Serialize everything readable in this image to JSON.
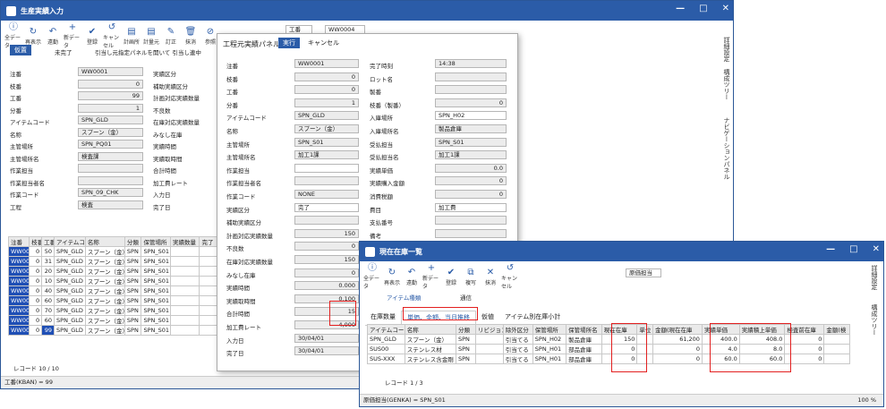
{
  "main_window": {
    "title": "生産実績入力",
    "toolbar": [
      {
        "label": "全データ",
        "icon": "info-icon"
      },
      {
        "label": "再表示",
        "icon": "refresh-icon"
      },
      {
        "label": "遠勤",
        "icon": "back-icon"
      },
      {
        "label": "新データ",
        "icon": "plus-icon"
      },
      {
        "label": "登録",
        "icon": "check-icon"
      },
      {
        "label": "キャンセル",
        "icon": "undo-icon"
      },
      {
        "label": "計画所",
        "icon": "doc-icon"
      },
      {
        "label": "計量元",
        "icon": "doc-icon"
      },
      {
        "label": "訂正",
        "icon": "pen-icon"
      },
      {
        "label": "抹消",
        "icon": "trash-icon"
      },
      {
        "label": "参照",
        "icon": "stop-icon"
      }
    ],
    "record_field": "WW0004",
    "nav_field": "工番",
    "toolbar2": {
      "lock": "仮置",
      "status": "未完了",
      "note": "引当し元指定パネルを開いて 引当し連中"
    },
    "labels": [
      "注番",
      "枝番",
      "工番",
      "分番",
      "アイテムコード",
      "名称",
      "主管場所",
      "主管場所名",
      "作業担当",
      "作業担当者名",
      "作業コード",
      "工程"
    ],
    "values": [
      "WW0001",
      "0",
      "99",
      "1",
      "SPN_GLD",
      "スプーン（金）",
      "SPN_PQ01",
      "検査課",
      "",
      "",
      "SPN_09_CHK",
      "検査"
    ],
    "labels2": [
      "実績区分",
      "補助実績区分",
      "計画対応実績数量",
      "不良数",
      "在庫対応実績数量",
      "みなし在庫",
      "実績時間",
      "実績取時間",
      "合計時間",
      "加工費レート",
      "入力日",
      "完了日"
    ],
    "grid_headers": [
      "注番",
      "枝番",
      "工番",
      "アイテムコード",
      "名称",
      "分類",
      "保管場所",
      "実績数量",
      "完了"
    ],
    "grid_rows": [
      [
        "WW0001",
        "0",
        "50",
        "SPN_GLD",
        "スプーン（金）",
        "SPN",
        "SPN_S01",
        "",
        "",
        ""
      ],
      [
        "WW0001",
        "0",
        "31",
        "SPN_GLD",
        "スプーン（金）",
        "SPN",
        "SPN_S01",
        "",
        "",
        ""
      ],
      [
        "WW0001",
        "0",
        "20",
        "SPN_GLD",
        "スプーン（金）",
        "SPN",
        "SPN_S01",
        "",
        "",
        ""
      ],
      [
        "WW0001",
        "0",
        "10",
        "SPN_GLD",
        "スプーン（金）",
        "SPN",
        "SPN_S01",
        "",
        "",
        ""
      ],
      [
        "WW0001",
        "0",
        "40",
        "SPN_GLD",
        "スプーン（金）",
        "SPN",
        "SPN_S01",
        "",
        "",
        ""
      ],
      [
        "WW0001",
        "0",
        "60",
        "SPN_GLD",
        "スプーン（金）",
        "SPN",
        "SPN_S01",
        "",
        "",
        ""
      ],
      [
        "WW0001",
        "0",
        "70",
        "SPN_GLD",
        "スプーン（金）",
        "SPN",
        "SPN_S01",
        "",
        "",
        ""
      ],
      [
        "WW0001",
        "0",
        "60",
        "SPN_GLD",
        "スプーン（金）",
        "SPN",
        "SPN_S01",
        "",
        "",
        ""
      ],
      [
        "WW0001",
        "0",
        "99",
        "SPN_GLD",
        "スプーン（金）",
        "SPN",
        "SPN_S01",
        "",
        "",
        ""
      ]
    ],
    "record_nav": "レコード 10 / 10",
    "status": "工番(KBAN) = 99",
    "side_tabs": [
      "詳細設定",
      "構成ツリー",
      "ナビゲーションパネル"
    ]
  },
  "panel": {
    "title": "工程元実績パネル",
    "exec": "実行",
    "cancel": "キャンセル",
    "left": [
      [
        "注番",
        "WW0001"
      ],
      [
        "枝番",
        "0"
      ],
      [
        "工番",
        "0"
      ],
      [
        "分番",
        "1"
      ],
      [
        "アイテムコード",
        "SPN_GLD"
      ],
      [
        "名称",
        "スプーン（金）"
      ],
      [
        "主管場所",
        "SPN_S01"
      ],
      [
        "主管場所名",
        "加工1課"
      ],
      [
        "作業担当",
        ""
      ],
      [
        "作業担当者名",
        ""
      ],
      [
        "作業コード",
        "NONE"
      ],
      [
        "実績区分",
        "完了"
      ],
      [
        "補助実績区分",
        ""
      ],
      [
        "計画対応実績数量",
        "150"
      ],
      [
        "不良数",
        "0"
      ],
      [
        "在庫対応実績数量",
        "150"
      ],
      [
        "みなし在庫",
        "0"
      ],
      [
        "実績時間",
        "0.000"
      ],
      [
        "実績取時間",
        "0.100"
      ],
      [
        "合計時間",
        "15"
      ],
      [
        "加工費レート",
        "4,000"
      ],
      [
        "入力日",
        "30/04/01"
      ],
      [
        "完了日",
        "30/04/01"
      ]
    ],
    "right": [
      [
        "完了時刻",
        "14:38"
      ],
      [
        "ロット名",
        ""
      ],
      [
        "製番",
        ""
      ],
      [
        "枝番（製番）",
        "0"
      ],
      [
        "入庫場所",
        "SPN_H02"
      ],
      [
        "入庫場所名",
        "製品倉庫"
      ],
      [
        "受払担当",
        "SPN_S01"
      ],
      [
        "受払担当名",
        "加工1課"
      ],
      [
        "実績単価",
        "0.0"
      ],
      [
        "実績購入金額",
        "0"
      ],
      [
        "消費税額",
        "0"
      ],
      [
        "費目",
        "加工費"
      ],
      [
        "支払番号",
        ""
      ],
      [
        "備考",
        ""
      ]
    ]
  },
  "stock_window": {
    "title": "現在在庫一覧",
    "toolbar": [
      {
        "label": "全データ",
        "icon": "info-icon"
      },
      {
        "label": "再表示",
        "icon": "refresh-icon"
      },
      {
        "label": "遠勤",
        "icon": "back-icon"
      },
      {
        "label": "新データ",
        "icon": "plus-icon"
      },
      {
        "label": "登録",
        "icon": "check-icon"
      },
      {
        "label": "複写",
        "icon": "copy-icon"
      },
      {
        "label": "抹消",
        "icon": "close-icon"
      },
      {
        "label": "キャンセル",
        "icon": "undo-icon"
      }
    ],
    "filter_field": "原価担当",
    "item_type": "アイテム種類",
    "mail": "通信",
    "tabs": [
      "在庫数量",
      "単価、金額、当月推移",
      "仮値",
      "アイテム別在庫小計"
    ],
    "headers": [
      "アイテムコード",
      "名称",
      "分類",
      "リビジョン",
      "除外区分",
      "保管場所",
      "保管場所名",
      "現在在庫",
      "単位",
      "金額(現在在庫",
      "実績単価",
      "実績積上単価",
      "検査前在庫",
      "金額(検"
    ],
    "rows": [
      [
        "SPN_GLD",
        "スプーン（金）",
        "SPN",
        "",
        "引当てる",
        "SPN_H02",
        "製品倉庫",
        "150",
        "",
        "61,200",
        "400.0",
        "408.0",
        "0",
        ""
      ],
      [
        "SUS00",
        "ステンレス材",
        "SPN",
        "",
        "引当てる",
        "SPN_H01",
        "部品倉庫",
        "0",
        "",
        "0",
        "4.0",
        "8.0",
        "0",
        ""
      ],
      [
        "SUS-XXX",
        "ステンレス含金剛",
        "SPN",
        "",
        "引当てる",
        "SPN_H01",
        "部品倉庫",
        "0",
        "",
        "0",
        "60.0",
        "60.0",
        "0",
        ""
      ]
    ],
    "record_nav": "レコード 1 / 3",
    "status": "原価担当(GENKA) = SPN_S01",
    "zoom": "100 %",
    "side_tabs": [
      "詳細設定",
      "構成ツリー"
    ]
  }
}
